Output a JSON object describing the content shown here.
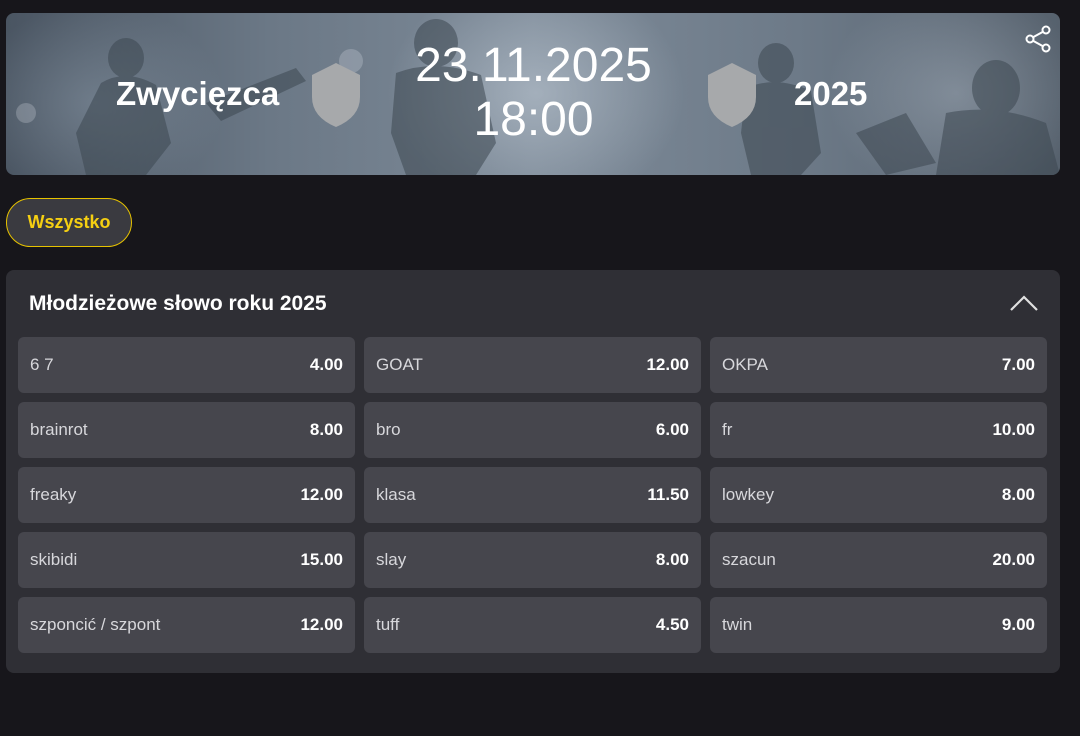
{
  "event": {
    "team_left": "Zwycięzca",
    "team_right": "2025",
    "date": "23.11.2025",
    "time": "18:00",
    "icons": {
      "share": "share-icon",
      "team_badge": "shield-icon"
    }
  },
  "filters": {
    "active": "Wszystko"
  },
  "market": {
    "title": "Młodzieżowe słowo roku 2025",
    "collapse_icon": "chevron-up-icon",
    "outcomes": [
      {
        "name": "6 7",
        "odd": "4.00"
      },
      {
        "name": "GOAT",
        "odd": "12.00"
      },
      {
        "name": "OKPA",
        "odd": "7.00"
      },
      {
        "name": "brainrot",
        "odd": "8.00"
      },
      {
        "name": "bro",
        "odd": "6.00"
      },
      {
        "name": "fr",
        "odd": "10.00"
      },
      {
        "name": "freaky",
        "odd": "12.00"
      },
      {
        "name": "klasa",
        "odd": "11.50"
      },
      {
        "name": "lowkey",
        "odd": "8.00"
      },
      {
        "name": "skibidi",
        "odd": "15.00"
      },
      {
        "name": "slay",
        "odd": "8.00"
      },
      {
        "name": "szacun",
        "odd": "20.00"
      },
      {
        "name": "szponcić / szpont",
        "odd": "12.00"
      },
      {
        "name": "tuff",
        "odd": "4.50"
      },
      {
        "name": "twin",
        "odd": "9.00"
      }
    ]
  },
  "colors": {
    "background": "#17161b",
    "panel": "#2f2f35",
    "cell": "#46464d",
    "accent": "#f5cf12"
  }
}
